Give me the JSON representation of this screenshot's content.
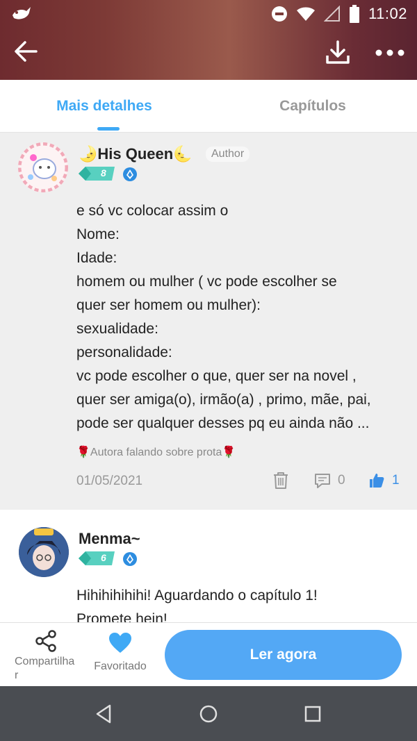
{
  "status_bar": {
    "time": "11:02"
  },
  "tabs": [
    {
      "label": "Mais detalhes",
      "active": true
    },
    {
      "label": "Capítulos",
      "active": false
    }
  ],
  "comments": [
    {
      "author": "🌛His Queen🌜",
      "tag": "Author",
      "level": "8",
      "lines": [
        "e só vc colocar assim o",
        "Nome:",
        "Idade:",
        "homem ou mulher ( vc pode escolher se",
        "quer ser homem ou mulher):",
        "sexualidade:",
        "personalidade:",
        "vc pode escolher o que, quer ser na novel ,",
        "quer ser amiga(o), irmão(a) , primo, mãe, pai,",
        "pode ser qualquer desses pq eu ainda não ..."
      ],
      "chapter_ref": "🌹Autora falando sobre prota🌹",
      "date": "01/05/2021",
      "reply_count": "0",
      "like_count": "1"
    },
    {
      "author": "Menma~",
      "level": "6",
      "lines": [
        "Hihihihihihi! Aguardando o capítulo 1!",
        "Promete hein!"
      ]
    }
  ],
  "bottom_bar": {
    "share_label": "Compartilhar",
    "favorite_label": "Favoritado",
    "read_label": "Ler agora"
  },
  "colors": {
    "accent": "#3fa9f5",
    "read_button": "#53a8f5",
    "like": "#3b8fe6",
    "level_badge": "#58d0c0"
  }
}
